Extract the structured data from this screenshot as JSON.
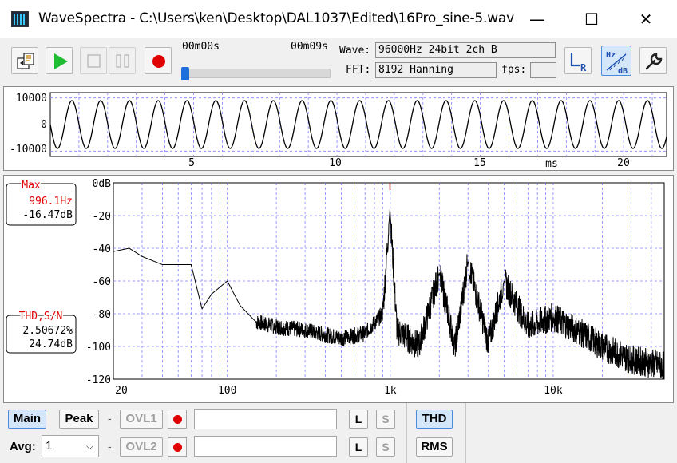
{
  "window": {
    "title": "WaveSpectra - C:\\Users\\ken\\Desktop\\DAL1037\\Edited\\16Pro_sine-5.wav",
    "minimize_glyph": "—",
    "maximize_glyph": "☐",
    "close_glyph": "✕"
  },
  "toolbar": {
    "icons": [
      "open-file-icon",
      "play-icon",
      "stop-icon",
      "pause-icon",
      "record-icon",
      "lr-channel-icon",
      "hz-db-scale-icon",
      "settings-wrench-icon"
    ],
    "pos_start": "00m00s",
    "pos_end": "00m09s",
    "seek_fraction": 0.0,
    "wave_label": "Wave:",
    "wave_value": "96000Hz 24bit 2ch B",
    "fft_label": "FFT:",
    "fft_value": "8192 Hanning",
    "fps_label": "fps:",
    "fps_value": ""
  },
  "waveform": {
    "y_ticks": [
      "10000",
      "0",
      "-10000"
    ],
    "x_ticks": [
      "5",
      "10",
      "15",
      "20"
    ],
    "x_unit": "ms"
  },
  "spectrum": {
    "y_ticks": [
      "0dB",
      "-20",
      "-40",
      "-60",
      "-80",
      "-100",
      "-120"
    ],
    "x_ticks": [
      "20",
      "100",
      "1k",
      "10k"
    ],
    "max_title": "Max",
    "max_freq": "996.1Hz",
    "max_level": "-16.47dB",
    "thd_title": "THD,S/N",
    "thd_value": "2.50672%",
    "sn_value": "24.74dB",
    "colors": {
      "accent_red": "#e00000",
      "grid": "#8080ff",
      "trace": "#000000"
    }
  },
  "chart_data": [
    {
      "type": "line",
      "title": "",
      "xlabel": "ms",
      "ylabel": "",
      "xlim": [
        0,
        21.5
      ],
      "ylim": [
        -12000,
        12000
      ],
      "series": [
        {
          "frequency_hz": 996.1,
          "amplitude": 9000
        }
      ],
      "grid": true
    },
    {
      "type": "line",
      "title": "",
      "xlabel": "",
      "ylabel": "",
      "x_scale": "log",
      "xlim": [
        20,
        48000
      ],
      "ylim": [
        -120,
        0
      ],
      "x": [
        20,
        25,
        30,
        40,
        50,
        60,
        70,
        80,
        100,
        120,
        150,
        200,
        300,
        500,
        700,
        900,
        996,
        1100,
        1500,
        2000,
        2500,
        3000,
        4000,
        5000,
        7000,
        10000,
        15000,
        20000,
        30000,
        48000
      ],
      "y": [
        -42,
        -40,
        -45,
        -50,
        -50,
        -50,
        -77,
        -68,
        -60,
        -75,
        -85,
        -88,
        -90,
        -95,
        -92,
        -80,
        -16,
        -90,
        -100,
        -55,
        -100,
        -48,
        -98,
        -60,
        -88,
        -82,
        -92,
        -100,
        -108,
        -112
      ],
      "grid": true
    }
  ],
  "bottom": {
    "main": "Main",
    "peak": "Peak",
    "dash": "-",
    "ovl1": "OVL1",
    "ovl2": "OVL2",
    "avg_label": "Avg:",
    "avg_value": "1",
    "l": "L",
    "s": "S",
    "thd": "THD",
    "rms": "RMS"
  }
}
